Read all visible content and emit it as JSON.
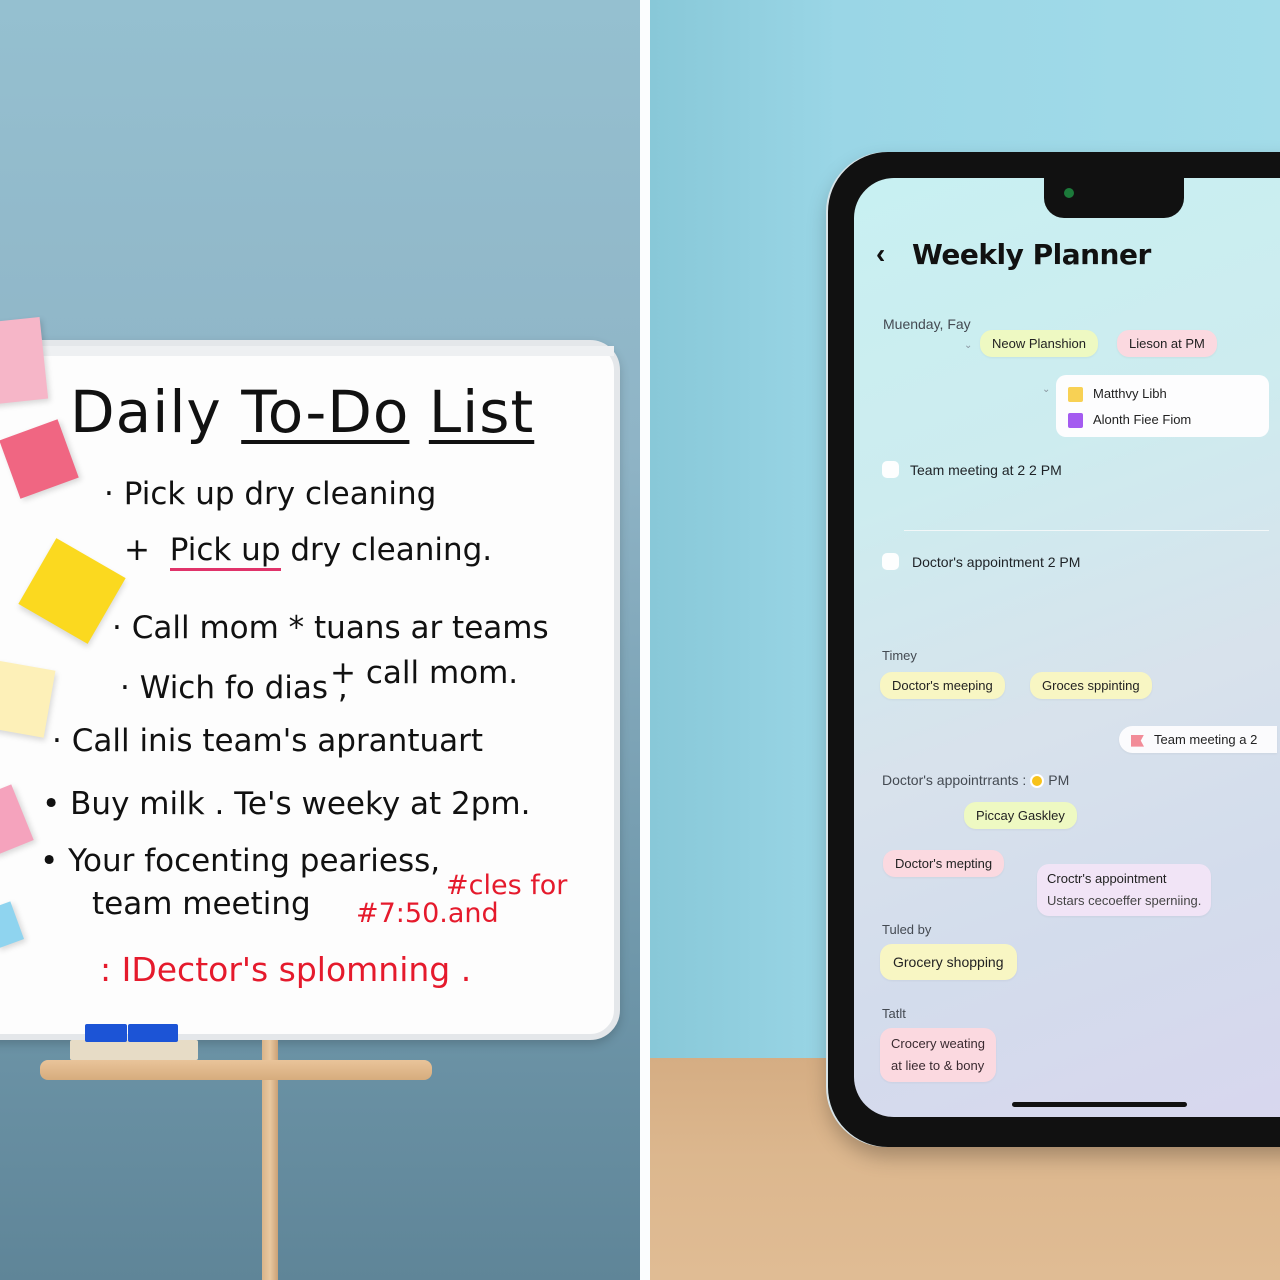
{
  "whiteboard": {
    "title_parts": [
      "Daily",
      "To-Do",
      "List"
    ],
    "lines": [
      {
        "bullet": "·",
        "text": "Pick up dry cleaning"
      },
      {
        "bullet": "+",
        "text_a": "Pick up",
        "text_b": "dry cleaning."
      },
      {
        "bullet": "·",
        "text": "Call mom * tuans ar teams"
      },
      {
        "bullet": "·",
        "text": "Wich fo dias ,"
      },
      {
        "text": "+ call mom."
      },
      {
        "bullet": "·",
        "text": "Call inis team's aprantuart"
      },
      {
        "bullet": "•",
        "text": "Buy milk . Te's weeky at 2pm."
      },
      {
        "bullet": "•",
        "text": "Your focenting peariess,"
      },
      {
        "text": "team meeting"
      },
      {
        "text": "#cles for"
      },
      {
        "text": "#7:50.and"
      },
      {
        "text": ": IDector's splomning ."
      }
    ],
    "colors": {
      "ink": "#111111",
      "red_ink": "#e51a2c",
      "eraser": "#1c54d6"
    }
  },
  "phone": {
    "back_icon": "chevron-left-icon",
    "back_glyph": "‹",
    "title": "Weekly Planner",
    "section_monday": {
      "label": "Muenday, Fay",
      "chips": [
        {
          "text": "Neow Planshion",
          "color": "lime"
        },
        {
          "text": "Lieson at PM",
          "color": "pink"
        }
      ],
      "dropdown": [
        {
          "text": "Matthvy Libh",
          "swatch": "#f8d154"
        },
        {
          "text": "Alonth Fiee Fiom",
          "swatch": "#a45bf0"
        }
      ]
    },
    "tasks": [
      {
        "text": "Team meeting at 2 2 PM",
        "checked": false
      },
      {
        "text": "Doctor's appointment 2 PM",
        "checked": false
      }
    ],
    "section_timey": {
      "label": "Timey",
      "chips": [
        {
          "text": "Doctor's meeping",
          "color": "yellow"
        },
        {
          "text": "Groces sppinting",
          "color": "yellow"
        }
      ],
      "team_card": "Team meeting  a 2",
      "appointments_label": "Doctor's appointrrants :",
      "appointments_suffix": "PM",
      "picay_chip": "Piccay Gaskley",
      "doctor_chip": "Doctor's mepting",
      "grocer_card": [
        "Croctr's appointment",
        "Ustars cecoeffer sperniing."
      ]
    },
    "section_tuled": {
      "label": "Tuled by",
      "chip": "Grocery shopping"
    },
    "section_tatit": {
      "label": "Tatlt",
      "card": [
        "Crocery weating",
        "at liee to & bony"
      ]
    }
  }
}
